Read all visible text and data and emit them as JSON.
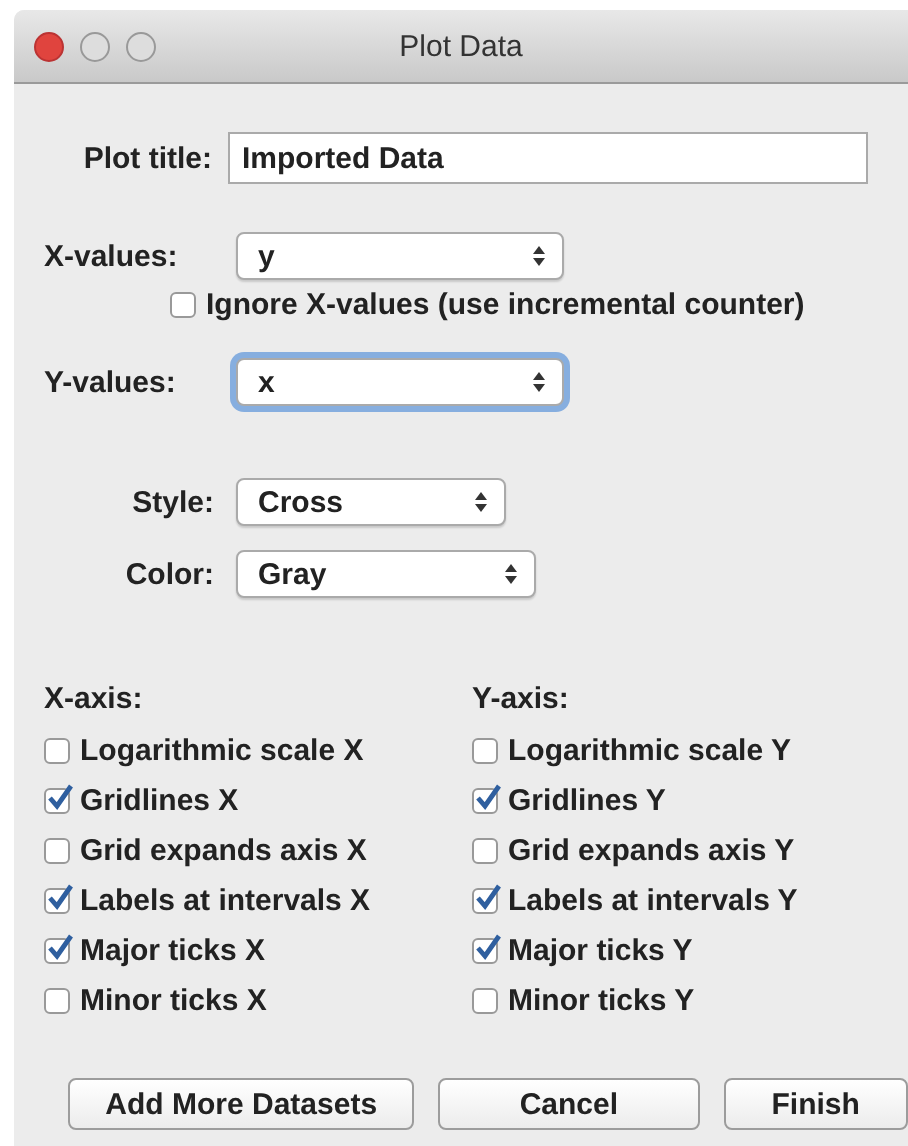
{
  "window": {
    "title": "Plot Data"
  },
  "plot_title": {
    "label": "Plot title:",
    "value": "Imported Data"
  },
  "x_values": {
    "label": "X-values:",
    "value": "y",
    "focused": false
  },
  "ignore_x": {
    "label": "Ignore X-values (use incremental counter)",
    "checked": false
  },
  "y_values": {
    "label": "Y-values:",
    "value": "x",
    "focused": true
  },
  "style": {
    "label": "Style:",
    "value": "Cross",
    "focused": false
  },
  "color": {
    "label": "Color:",
    "value": "Gray",
    "focused": false
  },
  "axes": [
    {
      "heading": "X-axis:",
      "options": [
        {
          "label": "Logarithmic scale X",
          "checked": false
        },
        {
          "label": "Gridlines X",
          "checked": true
        },
        {
          "label": "Grid expands axis X",
          "checked": false
        },
        {
          "label": "Labels at intervals X",
          "checked": true
        },
        {
          "label": "Major ticks X",
          "checked": true
        },
        {
          "label": "Minor ticks X",
          "checked": false
        }
      ]
    },
    {
      "heading": "Y-axis:",
      "options": [
        {
          "label": "Logarithmic scale Y",
          "checked": false
        },
        {
          "label": "Gridlines Y",
          "checked": true
        },
        {
          "label": "Grid expands axis Y",
          "checked": false
        },
        {
          "label": "Labels at intervals Y",
          "checked": true
        },
        {
          "label": "Major ticks Y",
          "checked": true
        },
        {
          "label": "Minor ticks Y",
          "checked": false
        }
      ]
    }
  ],
  "buttons": [
    "Add More Datasets",
    "Cancel",
    "Finish"
  ]
}
